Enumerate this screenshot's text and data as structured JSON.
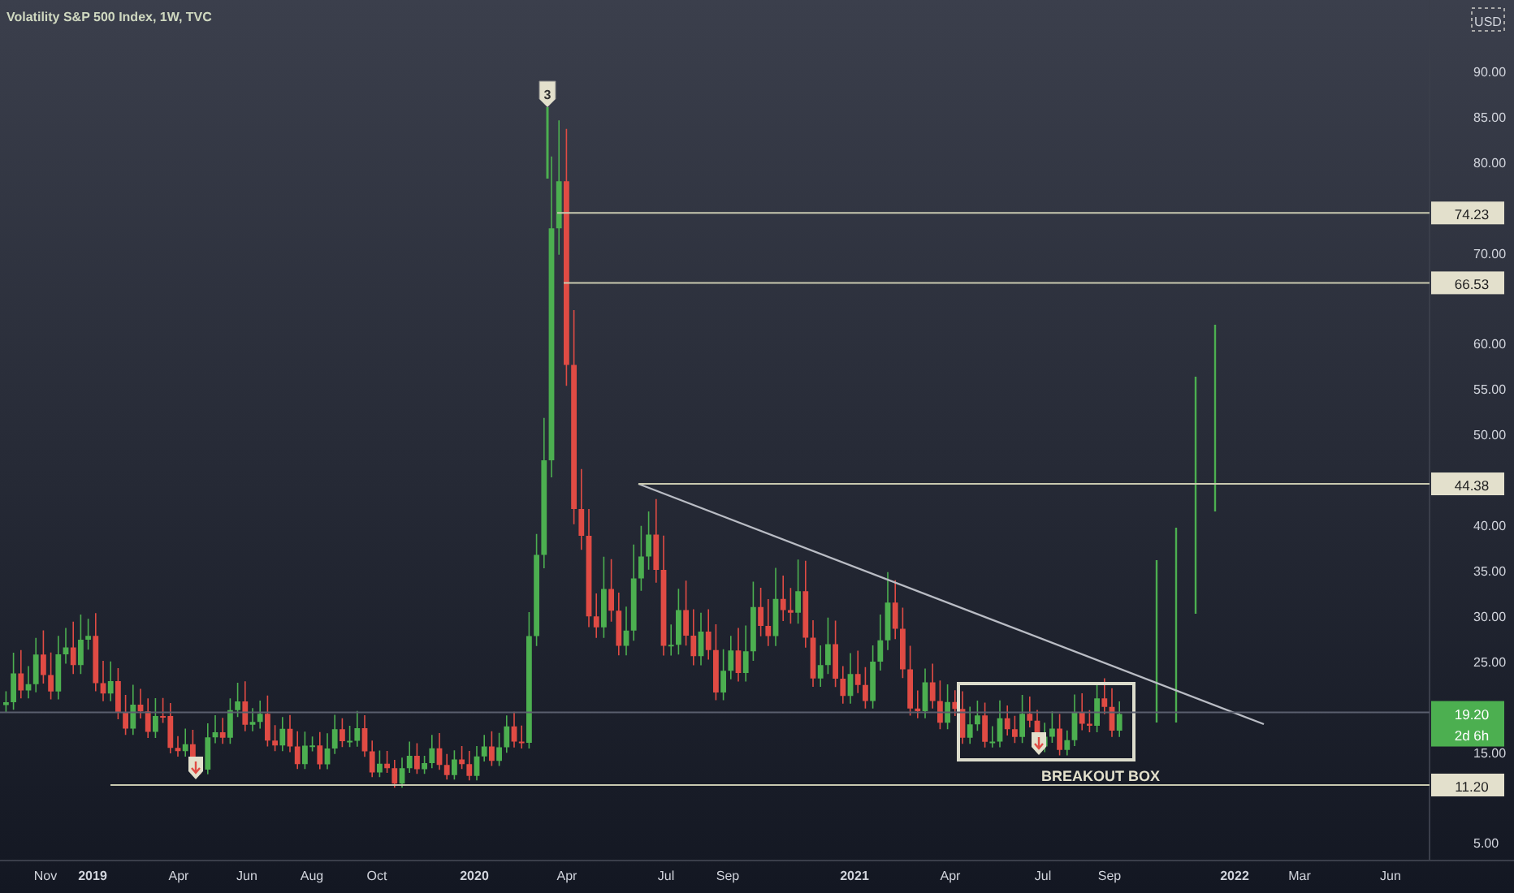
{
  "chart": {
    "title": "Volatility S&P 500 Index, 1W, TVC",
    "currency": "USD",
    "price_axis": [
      "90.00",
      "85.00",
      "80.00",
      "70.00",
      "60.00",
      "55.00",
      "50.00",
      "40.00",
      "35.00",
      "30.00",
      "25.00",
      "15.00",
      "5.00"
    ],
    "price_tags": [
      {
        "label": "74.23",
        "kind": "level"
      },
      {
        "label": "66.53",
        "kind": "level"
      },
      {
        "label": "44.38",
        "kind": "level"
      },
      {
        "label": "19.20",
        "kind": "last",
        "countdown": "2d 6h"
      },
      {
        "label": "11.20",
        "kind": "level"
      }
    ],
    "flag_marker": "3",
    "annotation": "BREAKOUT BOX",
    "time_axis": [
      {
        "label": "Nov",
        "kind": "month"
      },
      {
        "label": "2019",
        "kind": "year"
      },
      {
        "label": "Apr",
        "kind": "month"
      },
      {
        "label": "Jun",
        "kind": "month"
      },
      {
        "label": "Aug",
        "kind": "month"
      },
      {
        "label": "Oct",
        "kind": "month"
      },
      {
        "label": "2020",
        "kind": "year"
      },
      {
        "label": "Apr",
        "kind": "month"
      },
      {
        "label": "Jul",
        "kind": "month"
      },
      {
        "label": "Sep",
        "kind": "month"
      },
      {
        "label": "2021",
        "kind": "year"
      },
      {
        "label": "Apr",
        "kind": "month"
      },
      {
        "label": "Jul",
        "kind": "month"
      },
      {
        "label": "Sep",
        "kind": "month"
      },
      {
        "label": "2022",
        "kind": "year"
      },
      {
        "label": "Mar",
        "kind": "month"
      },
      {
        "label": "Jun",
        "kind": "month"
      }
    ]
  }
}
